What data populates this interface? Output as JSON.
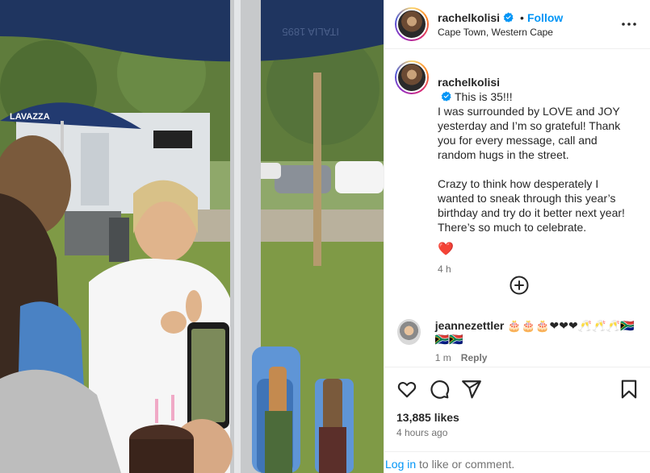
{
  "post": {
    "username": "rachelkolisi",
    "follow_label": "Follow",
    "separator": "•",
    "location": "Cape Town, Western Cape",
    "caption_lead": "This is 35!!!",
    "caption_rest": "I was surrounded by LOVE and JOY yesterday and I’m so grateful! Thank you for every message, call and random hugs in the street.\n\nCrazy to think how desperately I wanted to sneak through this year’s birthday and try do it better next year! There’s so much to celebrate.",
    "caption_emoji": "❤️",
    "caption_time": "4 h",
    "likes": "13,885 likes",
    "posted_ago": "4 hours ago"
  },
  "comment": {
    "username": "jeannezettler",
    "text": "🎂🎂🎂❤❤❤🥂🥂🥂🇿🇦🇿🇦🇿🇦",
    "time": "1 m",
    "reply_label": "Reply"
  },
  "footer": {
    "login_link": "Log in",
    "login_rest": " to like or comment."
  },
  "photo": {
    "sign_text": "LAVAZZA",
    "umbrella_text": "ITALIA 1895"
  },
  "icons": [
    "verified-badge-icon",
    "more-options-icon",
    "add-comment-icon",
    "heart-icon",
    "comment-icon",
    "share-icon",
    "bookmark-icon"
  ],
  "colors": {
    "accent": "#0095f6",
    "text": "#262626",
    "muted": "#737373",
    "heart": "#e0245e",
    "divider": "#efefef"
  }
}
